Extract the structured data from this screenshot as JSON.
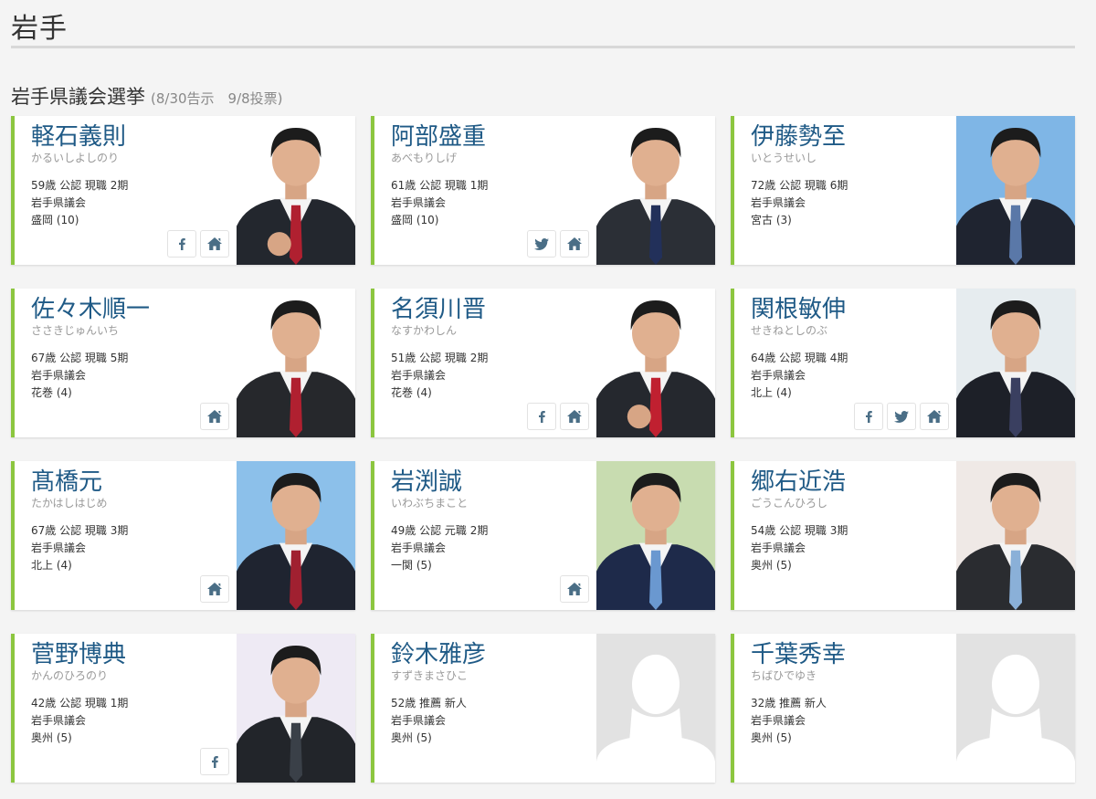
{
  "page": {
    "title": "岩手"
  },
  "section": {
    "title": "岩手県議会選挙",
    "subtitle": "(8/30告示　9/8投票)"
  },
  "candidates": [
    {
      "name": "軽石義則",
      "kana": "かるいしよしのり",
      "line1": "59歳 公認 現職 2期",
      "line2": "岩手県議会",
      "line3": "盛岡 (10)",
      "links": [
        "facebook-icon",
        "home-icon"
      ],
      "photo": "photo",
      "bg": "#ffffff",
      "suit": "#23272e",
      "tie": "#b02030",
      "pose": "fist"
    },
    {
      "name": "阿部盛重",
      "kana": "あべもりしげ",
      "line1": "61歳 公認 現職 1期",
      "line2": "岩手県議会",
      "line3": "盛岡 (10)",
      "links": [
        "twitter-icon",
        "home-icon"
      ],
      "photo": "photo",
      "bg": "#ffffff",
      "suit": "#2b2f36",
      "tie": "#22305a",
      "pose": "normal"
    },
    {
      "name": "伊藤勢至",
      "kana": "いとうせいし",
      "line1": "72歳 公認 現職 6期",
      "line2": "岩手県議会",
      "line3": "宮古 (3)",
      "links": [],
      "photo": "photo",
      "bg": "#7fb6e6",
      "suit": "#1f2430",
      "tie": "#5a78a8",
      "pose": "normal"
    },
    {
      "name": "佐々木順一",
      "kana": "ささきじゅんいち",
      "line1": "67歳 公認 現職 5期",
      "line2": "岩手県議会",
      "line3": "花巻 (4)",
      "links": [
        "home-icon"
      ],
      "photo": "photo",
      "bg": "#ffffff",
      "suit": "#26282c",
      "tie": "#b02030",
      "pose": "normal"
    },
    {
      "name": "名須川晋",
      "kana": "なすかわしん",
      "line1": "51歳 公認 現職 2期",
      "line2": "岩手県議会",
      "line3": "花巻 (4)",
      "links": [
        "facebook-icon",
        "home-icon"
      ],
      "photo": "photo",
      "bg": "#ffffff",
      "suit": "#25282e",
      "tie": "#c02030",
      "pose": "fist"
    },
    {
      "name": "関根敏伸",
      "kana": "せきねとしのぶ",
      "line1": "64歳 公認 現職 4期",
      "line2": "岩手県議会",
      "line3": "北上 (4)",
      "links": [
        "facebook-icon",
        "twitter-icon",
        "home-icon"
      ],
      "photo": "photo",
      "bg": "#e6ecef",
      "suit": "#1d2028",
      "tie": "#3a3f60",
      "pose": "normal"
    },
    {
      "name": "髙橋元",
      "kana": "たかはしはじめ",
      "line1": "67歳 公認 現職 3期",
      "line2": "岩手県議会",
      "line3": "北上 (4)",
      "links": [
        "home-icon"
      ],
      "photo": "photo",
      "bg": "#8cc0ea",
      "suit": "#1f2430",
      "tie": "#a02030",
      "pose": "normal"
    },
    {
      "name": "岩渕誠",
      "kana": "いわぶちまこと",
      "line1": "49歳 公認 元職 2期",
      "line2": "岩手県議会",
      "line3": "一関 (5)",
      "links": [
        "home-icon"
      ],
      "photo": "photo",
      "bg": "#c8dcb0",
      "suit": "#1e2a4a",
      "tie": "#6a98d0",
      "pose": "normal"
    },
    {
      "name": "郷右近浩",
      "kana": "ごうこんひろし",
      "line1": "54歳 公認 現職 3期",
      "line2": "岩手県議会",
      "line3": "奥州 (5)",
      "links": [],
      "photo": "photo",
      "bg": "#efe9e6",
      "suit": "#2a2c30",
      "tie": "#8ab0d8",
      "pose": "normal"
    },
    {
      "name": "菅野博典",
      "kana": "かんのひろのり",
      "line1": "42歳 公認 現職 1期",
      "line2": "岩手県議会",
      "line3": "奥州 (5)",
      "links": [
        "facebook-icon"
      ],
      "photo": "photo",
      "bg": "#eeeaf4",
      "suit": "#22252a",
      "tie": "#3a4048",
      "pose": "normal"
    },
    {
      "name": "鈴木雅彦",
      "kana": "すずきまさひこ",
      "line1": "52歳 推薦 新人",
      "line2": "岩手県議会",
      "line3": "奥州 (5)",
      "links": [],
      "photo": "placeholder",
      "bg": "#e2e2e2",
      "suit": "",
      "tie": "",
      "pose": ""
    },
    {
      "name": "千葉秀幸",
      "kana": "ちばひでゆき",
      "line1": "32歳 推薦 新人",
      "line2": "岩手県議会",
      "line3": "奥州 (5)",
      "links": [],
      "photo": "placeholder",
      "bg": "#e2e2e2",
      "suit": "",
      "tie": "",
      "pose": ""
    }
  ],
  "colors": {
    "accent": "#8cc63f",
    "name": "#1f5a86",
    "icon": "#4a6e86"
  }
}
